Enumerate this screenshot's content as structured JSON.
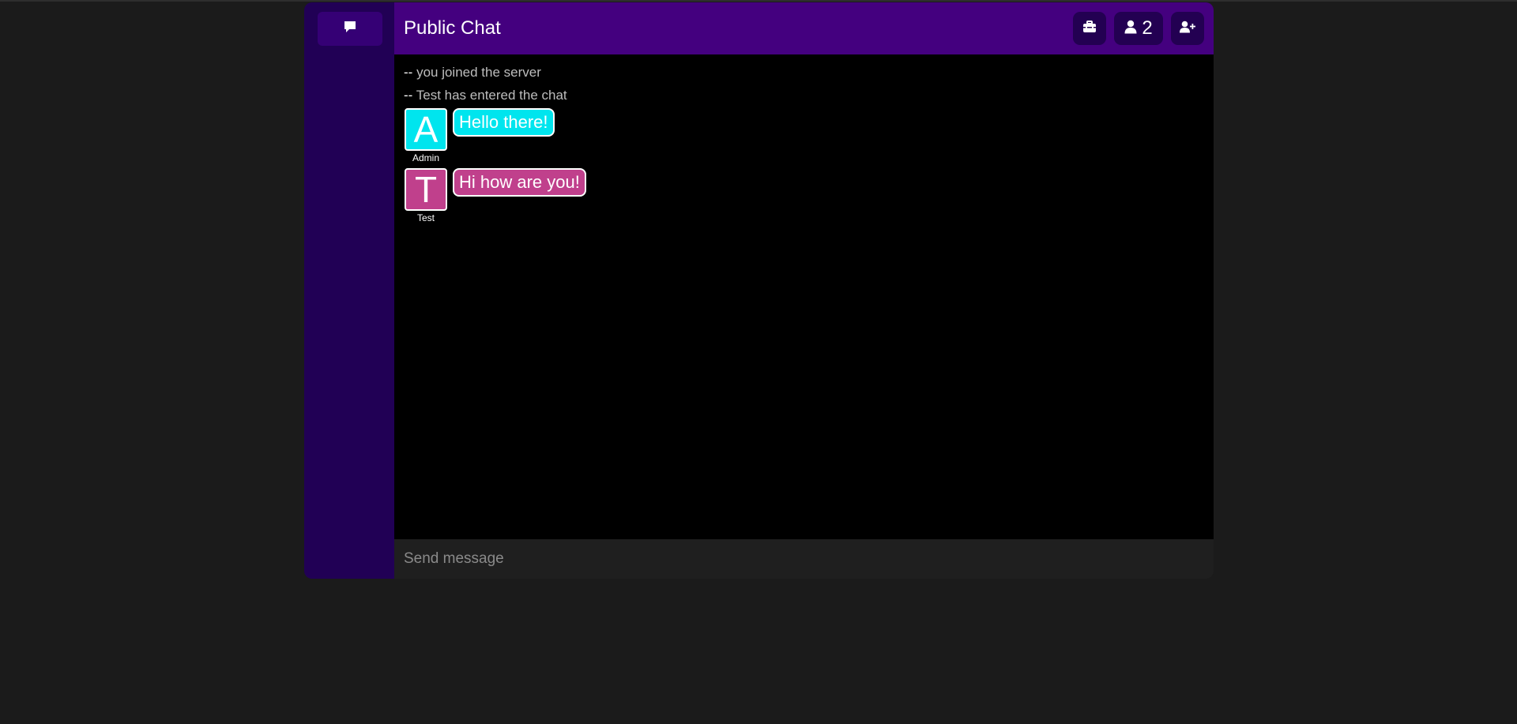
{
  "colors": {
    "page_background": "#1b1b1b",
    "sidebar": "#210055",
    "header": "#44007f",
    "header_button": "#230052",
    "chat_background": "#000000",
    "admin_color": "#00e5ee",
    "test_color": "#c0408c"
  },
  "sidebar": {
    "items": [
      {
        "icon": "chat-bubble-icon"
      }
    ]
  },
  "header": {
    "title": "Public Chat",
    "buttons": [
      {
        "icon": "toolbox-icon"
      },
      {
        "icon": "user-icon",
        "count": "2"
      },
      {
        "icon": "user-plus-icon"
      }
    ]
  },
  "messages": {
    "system": [
      {
        "dash": "--",
        "text": "you joined the server"
      },
      {
        "dash": "--",
        "text": "Test has entered the chat"
      }
    ],
    "chat": [
      {
        "initial": "A",
        "username": "Admin",
        "text": "Hello there!",
        "color": "#00e5ee"
      },
      {
        "initial": "T",
        "username": "Test",
        "text": "Hi how are you!",
        "color": "#c0408c"
      }
    ]
  },
  "input": {
    "placeholder": "Send message",
    "value": ""
  }
}
